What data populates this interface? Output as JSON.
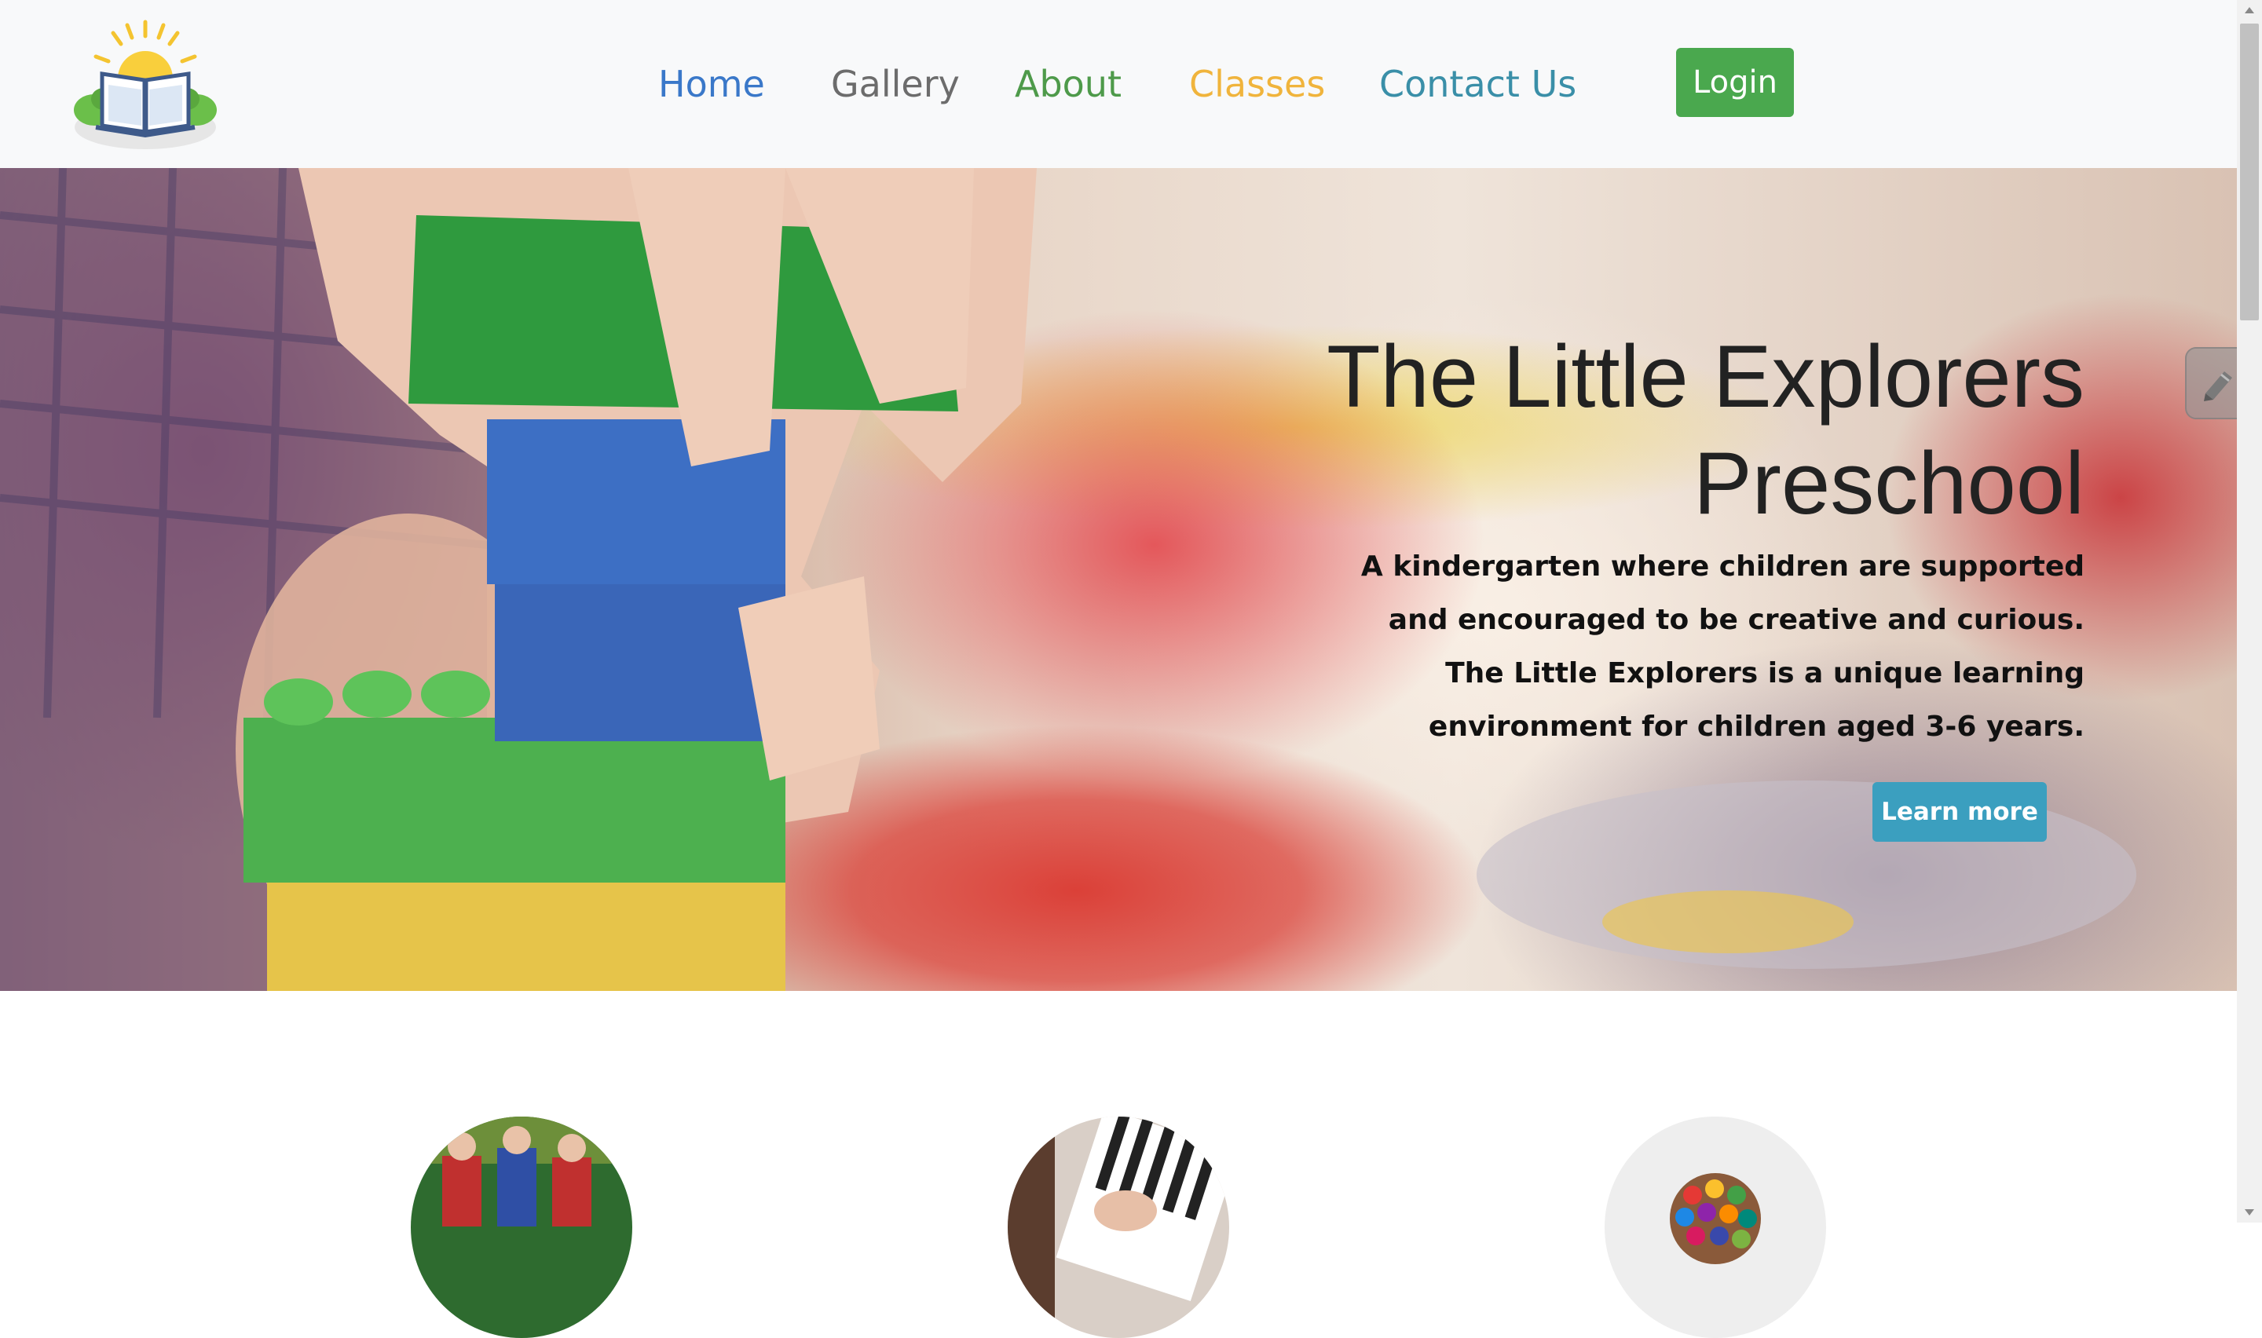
{
  "navbar": {
    "logo_icon": "open-book-sunrise-logo",
    "links": [
      {
        "label": "Home",
        "color": "#3a78c9"
      },
      {
        "label": "Gallery",
        "color": "#6c6c6c"
      },
      {
        "label": "About",
        "color": "#4e9a4a"
      },
      {
        "label": "Classes",
        "color": "#f0b43c"
      },
      {
        "label": "Contact Us",
        "color": "#3a8fa8"
      }
    ],
    "login_label": "Login",
    "login_color": "#4aa84e"
  },
  "hero": {
    "title_line1": "The Little Explorers",
    "title_line2": "Preschool",
    "text": "A kindergarten where children are supported and encouraged to be creative and curious. The Little Explorers is a unique learning environment for children aged 3-6 years.",
    "button_label": "Learn more",
    "button_color": "#3b9fbf"
  },
  "features": {
    "images": [
      "children-playing-photo",
      "piano-keys-photo",
      "colored-pencils-photo"
    ]
  },
  "side_widget_icon": "pencil-edit-icon"
}
